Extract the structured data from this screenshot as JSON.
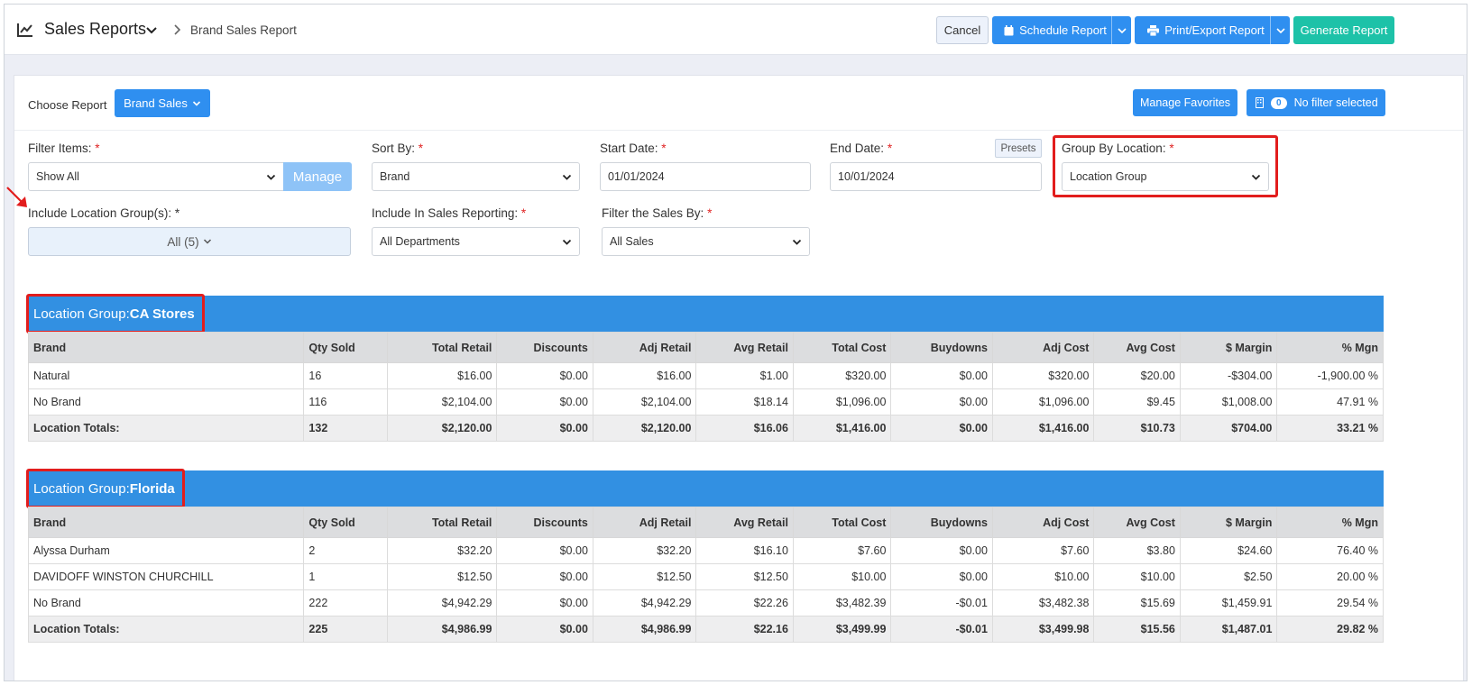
{
  "header": {
    "title": "Sales Reports",
    "breadcrumb": "Brand Sales Report",
    "buttons": {
      "cancel": "Cancel",
      "schedule": "Schedule Report",
      "print_export": "Print/Export Report",
      "generate": "Generate Report"
    }
  },
  "toolbar": {
    "choose_report_label": "Choose Report",
    "report_select": "Brand Sales",
    "manage_favorites": "Manage Favorites",
    "filter_count": "0",
    "no_filter": "No filter selected"
  },
  "filters": {
    "filter_items": {
      "label": "Filter Items:",
      "value": "Show All",
      "manage": "Manage"
    },
    "sort_by": {
      "label": "Sort By:",
      "value": "Brand"
    },
    "start_date": {
      "label": "Start Date:",
      "value": "01/01/2024"
    },
    "end_date": {
      "label": "End Date:",
      "value": "10/01/2024",
      "presets": "Presets"
    },
    "group_by_location": {
      "label": "Group By Location:",
      "value": "Location Group"
    },
    "include_location_groups": {
      "label": "Include Location Group(s): *",
      "value": "All (5)"
    },
    "include_in_sales": {
      "label": "Include In Sales Reporting:",
      "value": "All Departments"
    },
    "filter_sales_by": {
      "label": "Filter the Sales By:",
      "value": "All Sales"
    },
    "required_mark": "*"
  },
  "columns": [
    "Brand",
    "Qty Sold",
    "Total Retail",
    "Discounts",
    "Adj Retail",
    "Avg Retail",
    "Total Cost",
    "Buydowns",
    "Adj Cost",
    "Avg Cost",
    "$ Margin",
    "% Mgn"
  ],
  "groups": [
    {
      "prefix": "Location Group: ",
      "name": "CA Stores",
      "rows": [
        [
          "Natural",
          "16",
          "$16.00",
          "$0.00",
          "$16.00",
          "$1.00",
          "$320.00",
          "$0.00",
          "$320.00",
          "$20.00",
          "-$304.00",
          "-1,900.00 %"
        ],
        [
          "No Brand",
          "116",
          "$2,104.00",
          "$0.00",
          "$2,104.00",
          "$18.14",
          "$1,096.00",
          "$0.00",
          "$1,096.00",
          "$9.45",
          "$1,008.00",
          "47.91 %"
        ]
      ],
      "totals": [
        "Location Totals:",
        "132",
        "$2,120.00",
        "$0.00",
        "$2,120.00",
        "$16.06",
        "$1,416.00",
        "$0.00",
        "$1,416.00",
        "$10.73",
        "$704.00",
        "33.21 %"
      ]
    },
    {
      "prefix": "Location Group:",
      "name": "Florida",
      "rows": [
        [
          "Alyssa Durham",
          "2",
          "$32.20",
          "$0.00",
          "$32.20",
          "$16.10",
          "$7.60",
          "$0.00",
          "$7.60",
          "$3.80",
          "$24.60",
          "76.40 %"
        ],
        [
          "DAVIDOFF WINSTON CHURCHILL",
          "1",
          "$12.50",
          "$0.00",
          "$12.50",
          "$12.50",
          "$10.00",
          "$0.00",
          "$10.00",
          "$10.00",
          "$2.50",
          "20.00 %"
        ],
        [
          "No Brand",
          "222",
          "$4,942.29",
          "$0.00",
          "$4,942.29",
          "$22.26",
          "$3,482.39",
          "-$0.01",
          "$3,482.38",
          "$15.69",
          "$1,459.91",
          "29.54 %"
        ]
      ],
      "totals": [
        "Location Totals:",
        "225",
        "$4,986.99",
        "$0.00",
        "$4,986.99",
        "$22.16",
        "$3,499.99",
        "-$0.01",
        "$3,499.98",
        "$15.56",
        "$1,487.01",
        "29.82 %"
      ]
    }
  ],
  "colors": {
    "primary": "#2f8ff0",
    "teal": "#1dc2a8",
    "group_header": "#3290e2",
    "highlight": "#e21d1d"
  }
}
